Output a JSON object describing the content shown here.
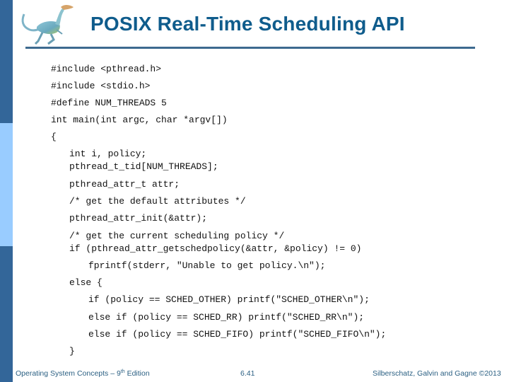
{
  "slide": {
    "title": "POSIX Real-Time Scheduling API",
    "logo": "dinosaur-logo",
    "colors": {
      "title": "#0f5c8c",
      "sidebar_dark": "#336699",
      "sidebar_light": "#99ccff",
      "rule": "#3d6a8f",
      "footer": "#2a5f82"
    }
  },
  "code": {
    "lines": [
      "#include <pthread.h>",
      "#include <stdio.h>",
      "#define NUM_THREADS 5",
      "int main(int argc, char *argv[])",
      "{",
      "int i, policy;",
      "pthread_t_tid[NUM_THREADS];",
      "pthread_attr_t attr;",
      "/* get the default attributes */",
      "pthread_attr_init(&attr);",
      "/* get the current scheduling policy */",
      "if (pthread_attr_getschedpolicy(&attr, &policy) != 0)",
      "fprintf(stderr, \"Unable to get policy.\\n\");",
      "else {",
      "if (policy == SCHED_OTHER) printf(\"SCHED_OTHER\\n\");",
      "else if (policy == SCHED_RR) printf(\"SCHED_RR\\n\");",
      "else if (policy == SCHED_FIFO) printf(\"SCHED_FIFO\\n\");",
      "}"
    ]
  },
  "footer": {
    "book_prefix": "Operating System Concepts – 9",
    "book_sup": "th",
    "book_suffix": " Edition",
    "page": "6.41",
    "copyright": "Silberschatz, Galvin and Gagne ©2013"
  }
}
